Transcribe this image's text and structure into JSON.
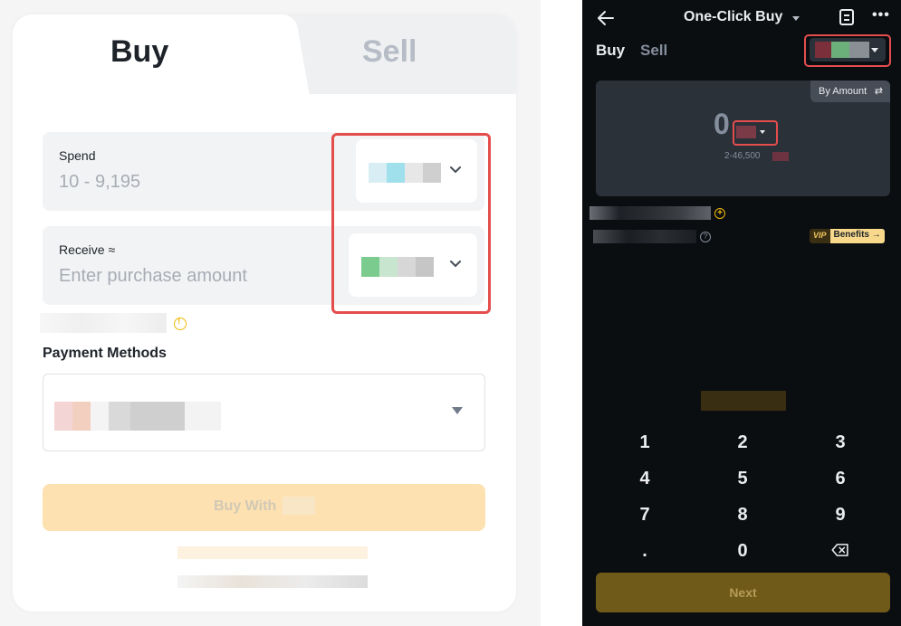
{
  "web": {
    "tabs": {
      "buy": "Buy",
      "sell": "Sell"
    },
    "spend": {
      "label": "Spend",
      "value": "10 - 9,195"
    },
    "receive": {
      "label": "Receive ≈",
      "placeholder": "Enter purchase amount"
    },
    "payment_methods_title": "Payment Methods",
    "buy_button_label": "Buy With",
    "colors": {
      "accent": "#f0b90b",
      "highlight_box": "#e54d4d",
      "button_disabled": "#fde1b1"
    }
  },
  "mobile": {
    "title": "One-Click Buy",
    "tabs": {
      "buy": "Buy",
      "sell": "Sell"
    },
    "mode_toggle": "By Amount",
    "amount": "0",
    "range": "2-46,500",
    "vip_tag": "VIP",
    "benefits_label": "Benefits →",
    "keypad": [
      "1",
      "2",
      "3",
      "4",
      "5",
      "6",
      "7",
      "8",
      "9",
      ".",
      "0"
    ],
    "next_label": "Next",
    "icons": [
      "back-arrow-icon",
      "dropdown-caret-icon",
      "document-icon",
      "more-icon",
      "swap-icon",
      "plus-circle-icon",
      "help-icon",
      "backspace-icon"
    ]
  }
}
